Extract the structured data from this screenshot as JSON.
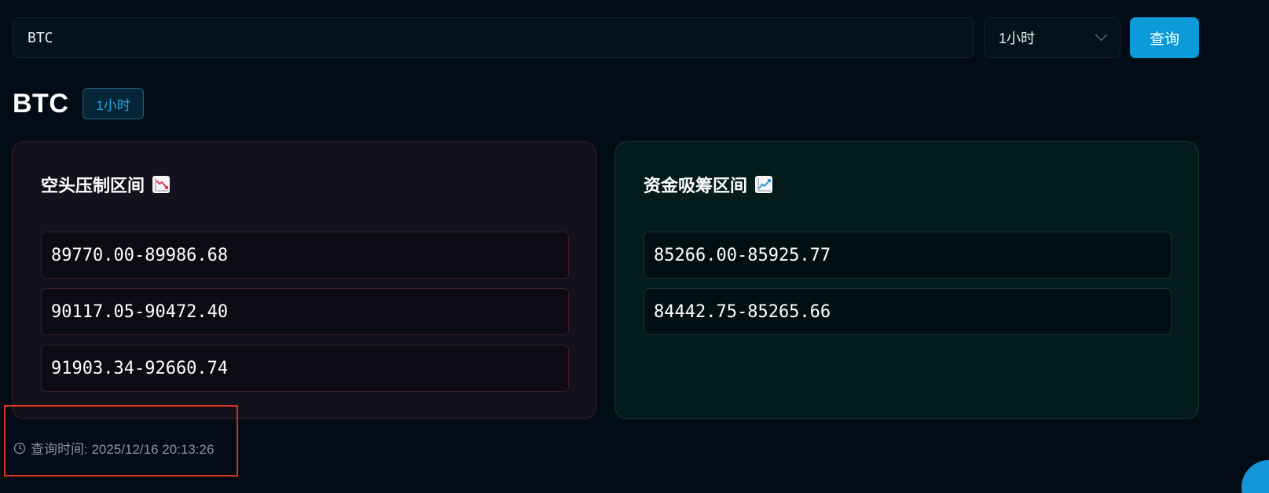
{
  "search": {
    "symbol_value": "BTC",
    "interval_selected": "1小时",
    "query_button_label": "查询"
  },
  "result": {
    "symbol": "BTC",
    "interval_badge": "1小时"
  },
  "cards": {
    "short": {
      "title": "空头压制区间",
      "icon": "chart-decreasing-icon",
      "ranges": [
        "89770.00-89986.68",
        "90117.05-90472.40",
        "91903.34-92660.74"
      ]
    },
    "long": {
      "title": "资金吸筹区间",
      "icon": "chart-increasing-icon",
      "ranges": [
        "85266.00-85925.77",
        "84442.75-85265.66"
      ]
    }
  },
  "footer": {
    "query_time_text": "查询时间: 2025/12/16 20:13:26"
  },
  "colors": {
    "background": "#020c16",
    "accent": "#0a9bd8",
    "highlight": "#d8331f"
  }
}
